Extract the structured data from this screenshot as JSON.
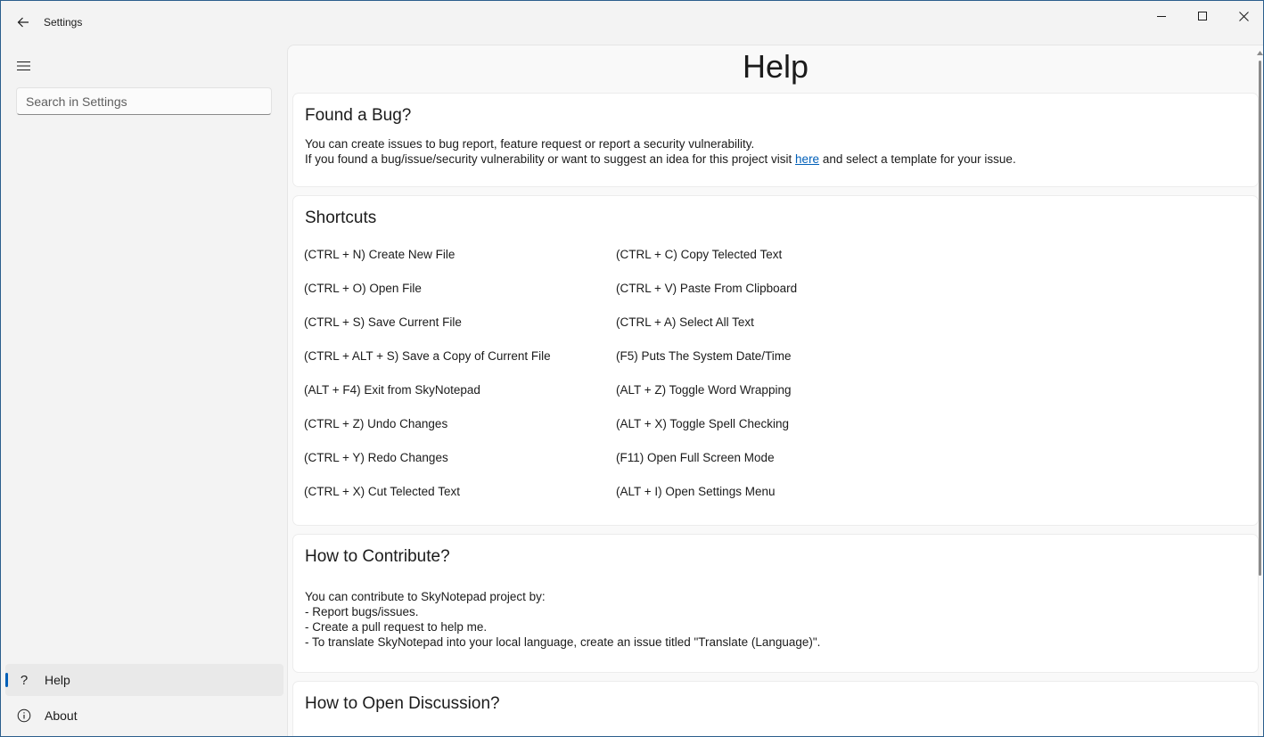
{
  "window": {
    "title": "Settings"
  },
  "sidebar": {
    "search_placeholder": "Search in Settings",
    "items": [
      {
        "label": "Help",
        "icon": "help-icon",
        "selected": true
      },
      {
        "label": "About",
        "icon": "info-icon",
        "selected": false
      }
    ]
  },
  "page": {
    "title": "Help"
  },
  "bug_card": {
    "title": "Found a Bug?",
    "line1": "You can create issues to bug report, feature request or report a security vulnerability.",
    "line2_before": "If you found a bug/issue/security vulnerability or want to suggest an idea for this project visit ",
    "link_text": "here",
    "line2_after": " and select a template for your issue."
  },
  "shortcuts_card": {
    "title": "Shortcuts",
    "left": [
      "(CTRL + N) Create New File",
      "(CTRL + O) Open File",
      "(CTRL + S) Save Current File",
      "(CTRL + ALT + S) Save a Copy of Current File",
      "(ALT + F4) Exit from SkyNotepad",
      "(CTRL + Z) Undo Changes",
      "(CTRL + Y) Redo Changes",
      "(CTRL + X) Cut Telected Text"
    ],
    "right": [
      "(CTRL + C) Copy Telected Text",
      "(CTRL + V) Paste From Clipboard",
      "(CTRL + A) Select All Text",
      "(F5) Puts The System Date/Time",
      "(ALT + Z) Toggle Word Wrapping",
      "(ALT + X) Toggle Spell Checking",
      "(F11) Open Full Screen Mode",
      "(ALT + I) Open Settings Menu"
    ]
  },
  "contribute_card": {
    "title": "How to Contribute?",
    "lines": [
      "You can contribute to SkyNotepad project by:",
      "- Report bugs/issues.",
      "- Create a pull request to help me.",
      "- To translate SkyNotepad into your local language, create an issue titled \"Translate (Language)\"."
    ]
  },
  "discussion_card": {
    "title": "How to Open Discussion?"
  },
  "colors": {
    "accent": "#005fb8",
    "background": "#f3f3f3",
    "card": "#ffffff"
  }
}
